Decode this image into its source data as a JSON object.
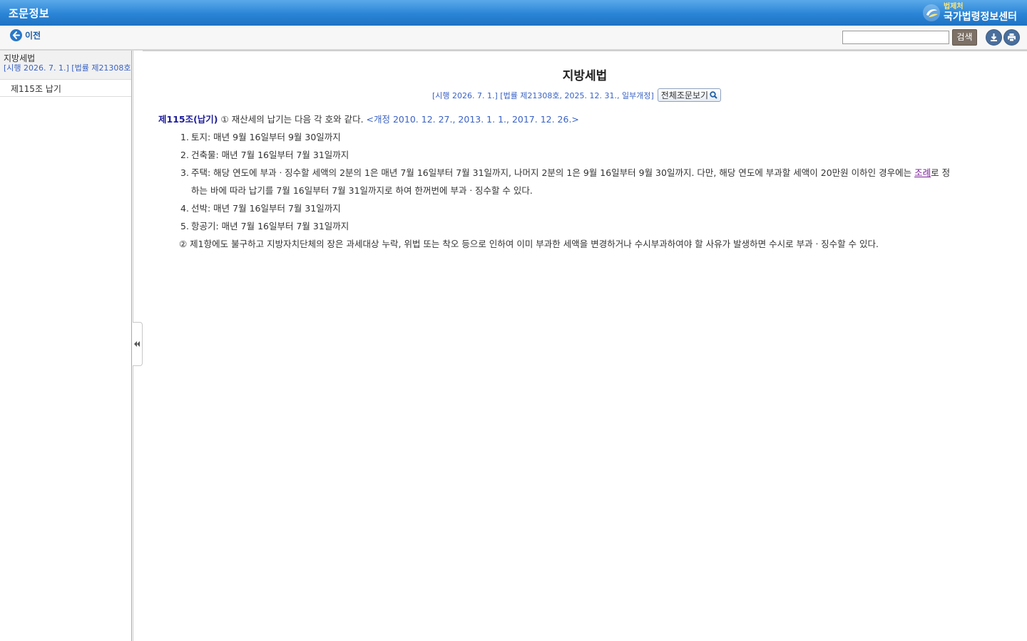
{
  "header": {
    "title": "조문정보",
    "logo_small": "법제처",
    "logo_big": "국가법령정보센터"
  },
  "toolbar": {
    "back_label": "이전",
    "search_value": "",
    "search_button": "검색",
    "download_icon": "download-icon",
    "print_icon": "print-icon"
  },
  "sidebar": {
    "law_name": "지방세법",
    "enforcement": "[시행 2026. 7. 1.] [법률 제21308호",
    "items": [
      {
        "label": "제115조 납기"
      }
    ]
  },
  "main": {
    "law_title": "지방세법",
    "enforcement": "[시행 2026. 7. 1.] [법률 제21308호, 2025. 12. 31., 일부개정]",
    "full_text_button": "전체조문보기",
    "article": {
      "head": "제115조(납기)",
      "para1_mark": "①",
      "para1_text": " 재산세의 납기는 다음 각 호와 같다. ",
      "amend": "<개정 2010. 12. 27., 2013. 1. 1., 2017. 12. 26.>",
      "items": [
        {
          "num": "1.",
          "text": "토지: 매년 9월 16일부터 9월 30일까지"
        },
        {
          "num": "2.",
          "text": "건축물: 매년 7월 16일부터 7월 31일까지"
        },
        {
          "num": "3.",
          "text_before_link": "주택: 해당 연도에 부과ㆍ징수할 세액의 2분의 1은 매년 7월 16일부터 7월 31일까지, 나머지 2분의 1은 9월 16일부터 9월 30일까지. 다만, 해당 연도에 부과할 세액이 20만원 이하인 경우에는 ",
          "link": "조례",
          "text_after_link": "로 정",
          "text_cont": "하는 바에 따라 납기를 7월 16일부터 7월 31일까지로 하여 한꺼번에 부과ㆍ징수할 수 있다."
        },
        {
          "num": "4.",
          "text": "선박: 매년 7월 16일부터 7월 31일까지"
        },
        {
          "num": "5.",
          "text": "항공기: 매년 7월 16일부터 7월 31일까지"
        }
      ],
      "para2": "② 제1항에도 불구하고 지방자치단체의 장은 과세대상 누락, 위법 또는 착오 등으로 인하여 이미 부과한 세액을 변경하거나 수시부과하여야 할 사유가 발생하면 수시로 부과ㆍ징수할 수 있다."
    }
  },
  "colors": {
    "header_blue": "#2a84d6",
    "article_head": "#1d1d9a",
    "amend_blue": "#3a62c4",
    "link_purple": "#7a1a9a"
  }
}
